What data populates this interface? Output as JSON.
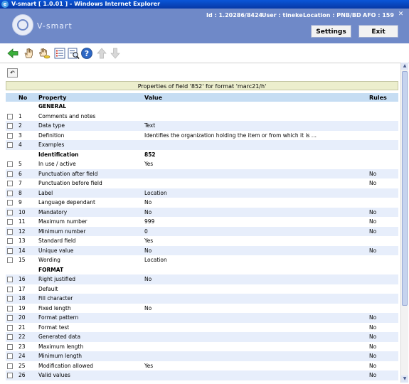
{
  "window": {
    "title": "V-smart [ 1.0.01 ] - Windows Internet Explorer"
  },
  "header": {
    "logo_text": "V-smart",
    "id_text": "Id : 1.20286/8424",
    "user_text": "User : tineke",
    "location_text": "Location : PNB/BD",
    "afo_text": "AFO : 159",
    "close_symbol": "✕",
    "settings_label": "Settings",
    "exit_label": "Exit"
  },
  "toolbar": {
    "icons": [
      "back-arrow-icon",
      "hand-select-icon",
      "hand-coins-icon",
      "list-details-icon",
      "search-list-icon",
      "help-icon",
      "arrow-up-icon",
      "arrow-down-icon"
    ]
  },
  "form": {
    "undo_symbol": "↶",
    "title": "Properties of field '852' for format 'marc21/h'",
    "columns": {
      "no": "No",
      "property": "Property",
      "value": "Value",
      "rules": "Rules"
    },
    "rows": [
      {
        "type": "section",
        "property": "GENERAL",
        "value": ""
      },
      {
        "no": "1",
        "property": "Comments and notes",
        "value": "",
        "rules": ""
      },
      {
        "no": "2",
        "property": "Data type",
        "value": "Text",
        "rules": ""
      },
      {
        "no": "3",
        "property": "Definition",
        "value": "Identifies the organization holding the item or from which it is ...",
        "rules": ""
      },
      {
        "no": "4",
        "property": "Examples",
        "value": "",
        "rules": ""
      },
      {
        "type": "section",
        "property": "Identification",
        "value": "852"
      },
      {
        "no": "5",
        "property": "In use / active",
        "value": "Yes",
        "rules": ""
      },
      {
        "no": "6",
        "property": "Punctuation after field",
        "value": "",
        "rules": "No"
      },
      {
        "no": "7",
        "property": "Punctuation before field",
        "value": "",
        "rules": "No"
      },
      {
        "no": "8",
        "property": "Label",
        "value": "Location",
        "rules": ""
      },
      {
        "no": "9",
        "property": "Language dependant",
        "value": "No",
        "rules": ""
      },
      {
        "no": "10",
        "property": "Mandatory",
        "value": "No",
        "rules": "No"
      },
      {
        "no": "11",
        "property": "Maximum number",
        "value": "999",
        "rules": "No"
      },
      {
        "no": "12",
        "property": "Minimum number",
        "value": "0",
        "rules": "No"
      },
      {
        "no": "13",
        "property": "Standard field",
        "value": "Yes",
        "rules": ""
      },
      {
        "no": "14",
        "property": "Unique value",
        "value": "No",
        "rules": "No"
      },
      {
        "no": "15",
        "property": "Wording",
        "value": "Location",
        "rules": ""
      },
      {
        "type": "section",
        "property": "FORMAT",
        "value": ""
      },
      {
        "no": "16",
        "property": "Right justified",
        "value": "No",
        "rules": ""
      },
      {
        "no": "17",
        "property": "Default",
        "value": "",
        "rules": ""
      },
      {
        "no": "18",
        "property": "Fill character",
        "value": "",
        "rules": ""
      },
      {
        "no": "19",
        "property": "Fixed length",
        "value": "No",
        "rules": ""
      },
      {
        "no": "20",
        "property": "Format pattern",
        "value": "",
        "rules": "No"
      },
      {
        "no": "21",
        "property": "Format test",
        "value": "",
        "rules": "No"
      },
      {
        "no": "22",
        "property": "Generated data",
        "value": "",
        "rules": "No"
      },
      {
        "no": "23",
        "property": "Maximum length",
        "value": "",
        "rules": "No"
      },
      {
        "no": "24",
        "property": "Minimum length",
        "value": "",
        "rules": "No"
      },
      {
        "no": "25",
        "property": "Modification allowed",
        "value": "Yes",
        "rules": "No"
      },
      {
        "no": "26",
        "property": "Valid values",
        "value": "",
        "rules": "No"
      }
    ]
  }
}
